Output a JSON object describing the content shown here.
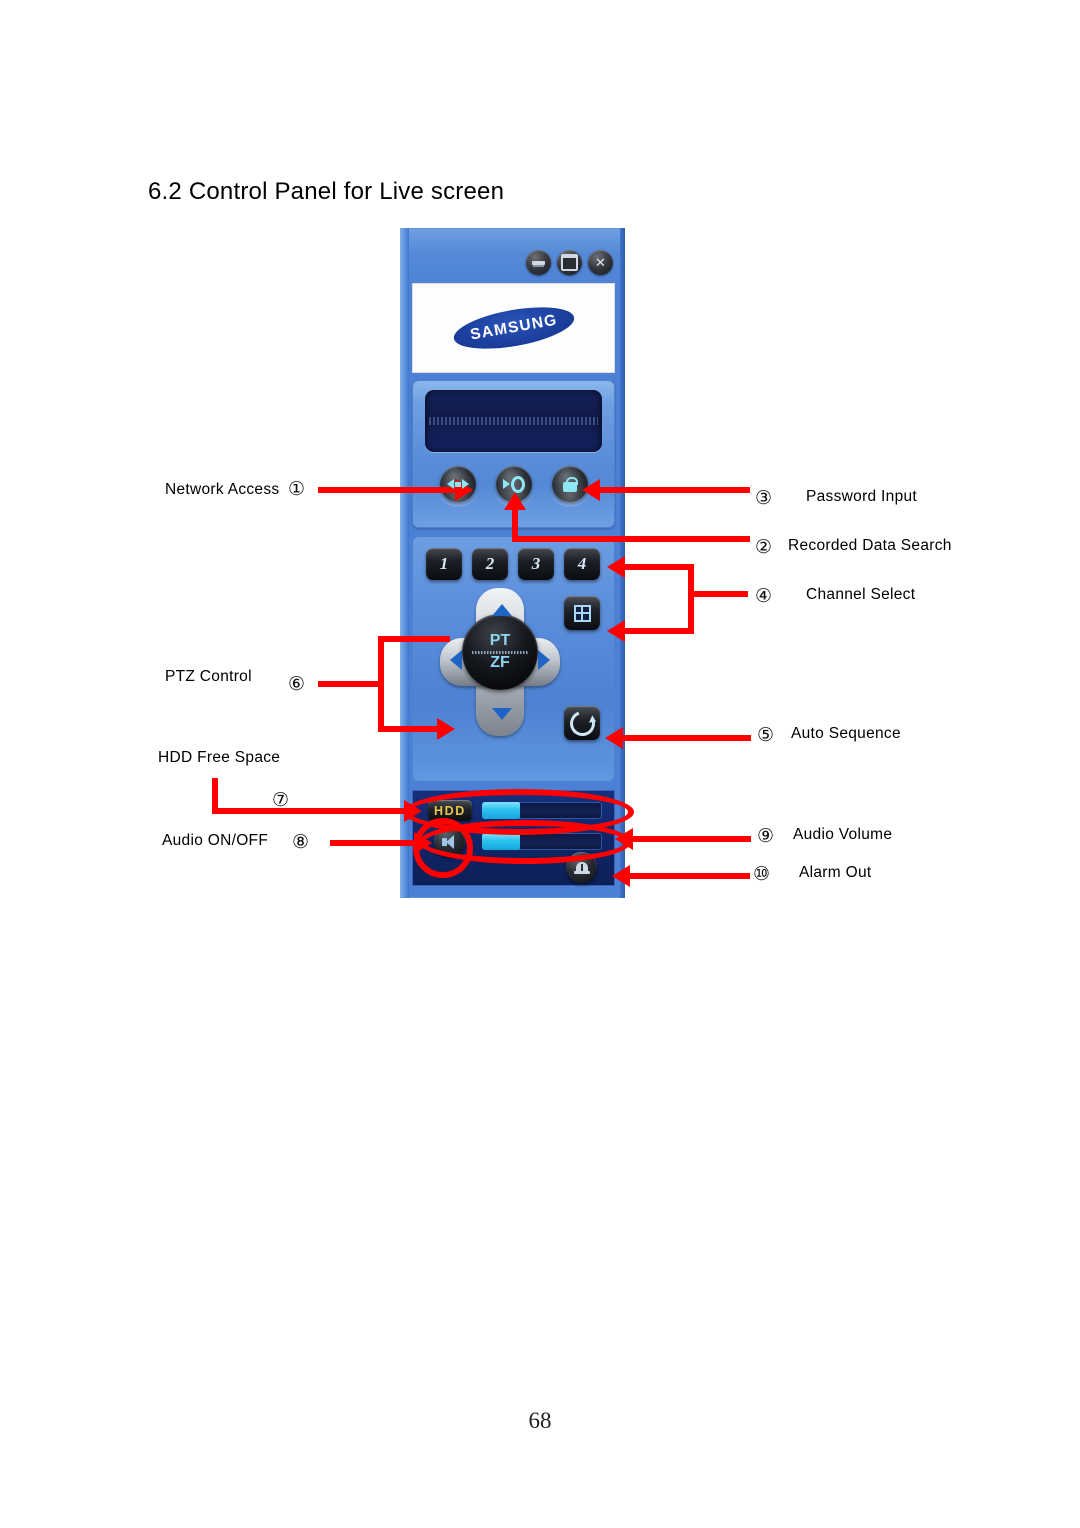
{
  "document": {
    "section_title": "6.2 Control Panel for Live screen",
    "page_number": "68"
  },
  "panel": {
    "brand": "SAMSUNG",
    "window_controls": {
      "minimize": "minimize",
      "maximize": "maximize",
      "close": "✕"
    },
    "buttons": {
      "network_access": "network-access",
      "recorded_data_search": "recorded-data-search",
      "password_input": "password-input",
      "quad_view": "quad-view",
      "auto_sequence": "auto-sequence",
      "audio_on_off": "audio-on-off",
      "alarm_out": "alarm-out"
    },
    "channels": [
      "1",
      "2",
      "3",
      "4"
    ],
    "ptz": {
      "label_top": "PT",
      "label_bottom": "ZF",
      "up": "▲",
      "down": "▼",
      "left": "◀",
      "right": "▶"
    },
    "hdd": {
      "badge": "HDD",
      "fill_percent": 32
    },
    "audio": {
      "fill_percent": 32
    },
    "colors": {
      "panel_blue": "#4c80d4",
      "lcd_navy": "#101a49",
      "bottom_navy": "#102566",
      "accent_cyan": "#2fc2ef",
      "annotation_red": "#fe0000",
      "hdd_gold": "#e8c64a"
    }
  },
  "annotations": {
    "left": [
      {
        "num": "①",
        "label": "Network Access"
      },
      {
        "num": "⑥",
        "label": "PTZ Control"
      },
      {
        "num": "⑦",
        "label": "HDD Free Space"
      },
      {
        "num": "⑧",
        "label": "Audio ON/OFF"
      }
    ],
    "right": [
      {
        "num": "③",
        "label": "Password Input"
      },
      {
        "num": "②",
        "label": "Recorded Data Search"
      },
      {
        "num": "④",
        "label": "Channel Select"
      },
      {
        "num": "⑤",
        "label": "Auto Sequence"
      },
      {
        "num": "⑨",
        "label": "Audio Volume"
      },
      {
        "num": "⑩",
        "label": "Alarm Out"
      }
    ]
  }
}
